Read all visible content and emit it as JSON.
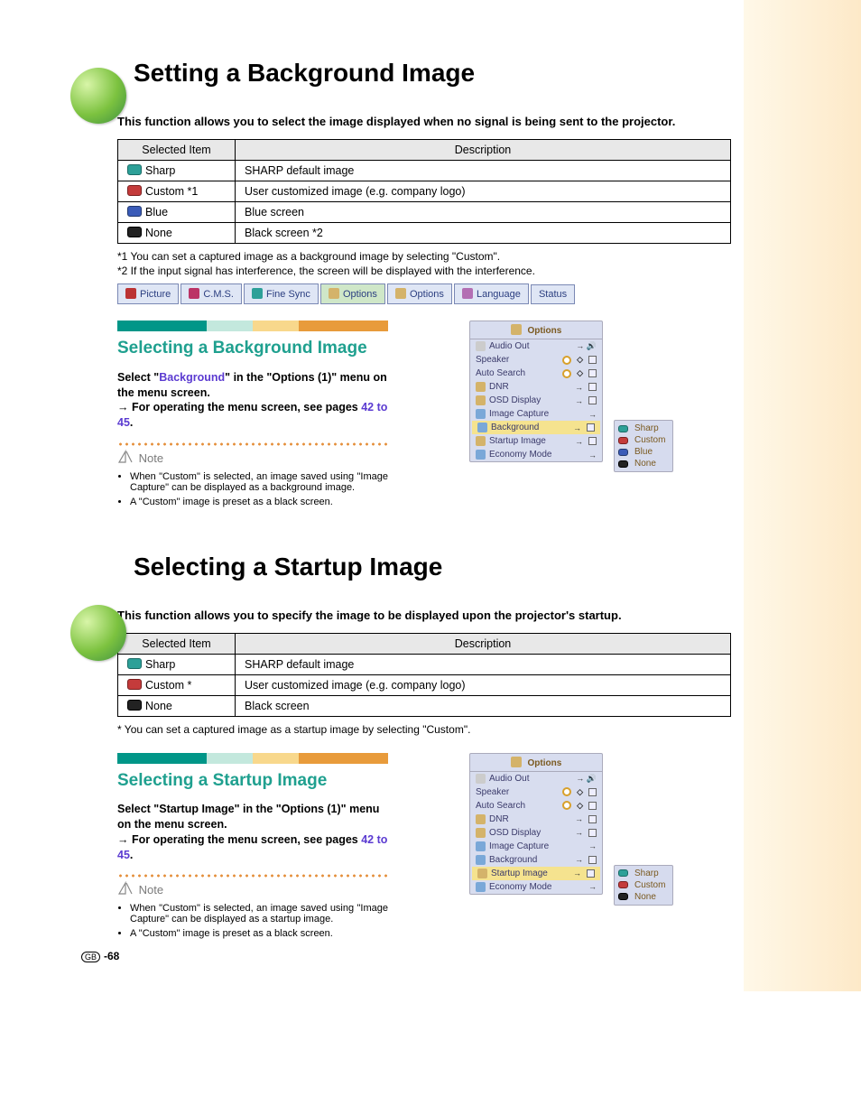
{
  "section1": {
    "title": "Setting a Background Image",
    "intro": "This function allows you to select the image displayed when no signal is being sent to the projector.",
    "table": {
      "head_item": "Selected Item",
      "head_desc": "Description",
      "rows": [
        {
          "item": "Sharp",
          "desc": "SHARP default image"
        },
        {
          "item": "Custom *1",
          "desc": "User customized image (e.g. company logo)"
        },
        {
          "item": "Blue",
          "desc": "Blue screen"
        },
        {
          "item": "None",
          "desc": "Black screen *2"
        }
      ]
    },
    "foot1": "*1 You can set a captured image as a background image by selecting \"Custom\".",
    "foot2": "*2 If the input signal has interference, the screen will be displayed with the interference."
  },
  "tabs": {
    "picture": "Picture",
    "cms": "C.M.S.",
    "finesync": "Fine Sync",
    "options1": "Options",
    "options2": "Options",
    "language": "Language",
    "status": "Status"
  },
  "sub1": {
    "title": "Selecting a Background Image",
    "body_a": "Select \"",
    "body_link": "Background",
    "body_b": "\" in the \"Options (1)\" menu on the menu screen.",
    "body_c": "→ For operating the menu screen, see pages ",
    "body_pages": "42 to 45",
    "note_label": "Note",
    "notes": [
      "When \"Custom\" is selected, an image saved using \"Image Capture\" can be displayed as a background image.",
      "A \"Custom\" image is preset as a black screen."
    ]
  },
  "osd": {
    "head": "Options",
    "rows": [
      "Audio Out",
      "Speaker",
      "Auto Search",
      "DNR",
      "OSD Display",
      "Image Capture",
      "Background",
      "Startup Image",
      "Economy Mode"
    ],
    "popup1": [
      "Sharp",
      "Custom",
      "Blue",
      "None"
    ],
    "popup2": [
      "Sharp",
      "Custom",
      "None"
    ]
  },
  "section2": {
    "title": "Selecting a Startup Image",
    "intro": "This function allows you to specify the image to be displayed upon the projector's startup.",
    "table": {
      "head_item": "Selected Item",
      "head_desc": "Description",
      "rows": [
        {
          "item": "Sharp",
          "desc": "SHARP default image"
        },
        {
          "item": "Custom *",
          "desc": "User customized image (e.g. company logo)"
        },
        {
          "item": "None",
          "desc": "Black screen"
        }
      ]
    },
    "foot": "* You can set a captured image as a startup image by selecting \"Custom\"."
  },
  "sub2": {
    "title": "Selecting a Startup Image",
    "body_a": "Select \"Startup Image\" in the \"Options (1)\" menu on the menu screen.",
    "body_c": "→ For operating the menu screen, see pages ",
    "body_pages": "42 to 45",
    "note_label": "Note",
    "notes": [
      "When \"Custom\" is selected, an image saved using \"Image Capture\" can be displayed as a startup image.",
      "A \"Custom\" image is preset as a black screen."
    ]
  },
  "pagenum": "-68",
  "gb": "GB"
}
